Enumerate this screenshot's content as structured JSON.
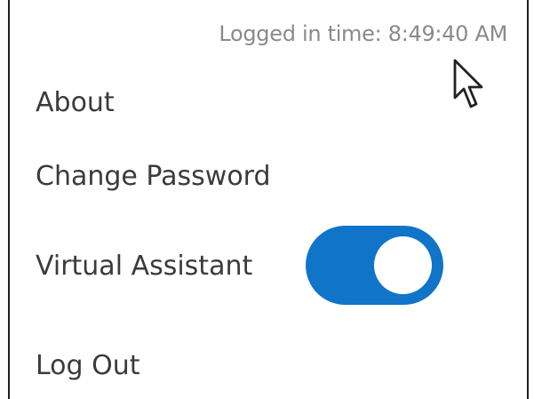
{
  "session": {
    "logged_in_label": "Logged in time: 8:49:40 AM"
  },
  "menu": {
    "items": [
      {
        "label": "About"
      },
      {
        "label": "Change Password"
      },
      {
        "label": "Virtual Assistant"
      },
      {
        "label": "Log Out"
      }
    ],
    "virtual_assistant_toggle": {
      "state": "on",
      "on_color": "#1074C9",
      "knob_color": "#FFFFFF"
    }
  },
  "icons": {
    "cursor": "mouse-pointer-icon"
  }
}
